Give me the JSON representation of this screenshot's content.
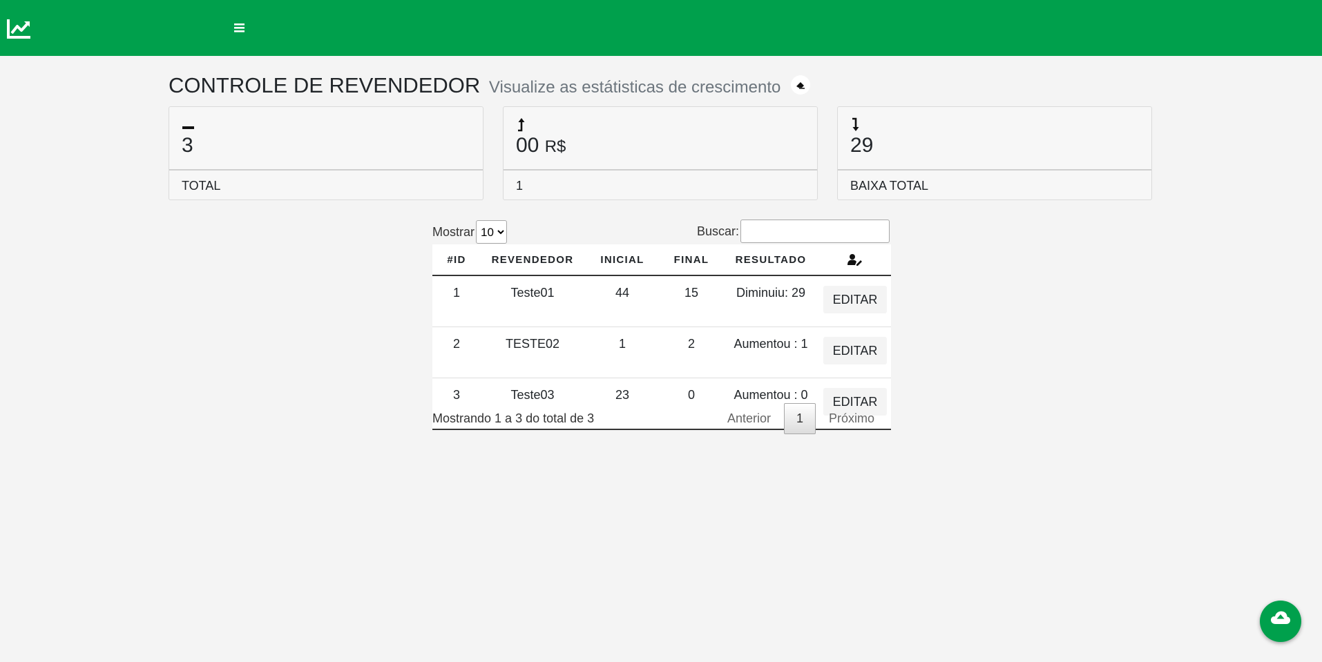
{
  "header": {
    "brand_icon": "chart-line-icon",
    "menu_icon": "bars-icon",
    "accent": "#00a04c"
  },
  "page": {
    "title": "CONTROLE DE REVENDEDOR",
    "subtitle": "Visualize as estátisticas de crescimento",
    "title_icon": "eraser-icon"
  },
  "cards": [
    {
      "icon": "minus-icon",
      "value": "3",
      "unit": "",
      "footer": "TOTAL"
    },
    {
      "icon": "arrow-up-icon",
      "value": "00",
      "unit": "R$",
      "footer": "1"
    },
    {
      "icon": "arrow-down-icon",
      "value": "29",
      "unit": "",
      "footer": "BAIXA TOTAL"
    }
  ],
  "table_controls": {
    "length_label": "Mostrar",
    "length_value": "10",
    "search_label": "Buscar:",
    "search_value": ""
  },
  "table": {
    "columns": [
      "#ID",
      "REVENDEDOR",
      "INICIAL",
      "FINAL",
      "RESULTADO"
    ],
    "action_column_icon": "user-edit-icon",
    "rows": [
      {
        "id": "1",
        "revendedor": "Teste01",
        "inicial": "44",
        "final": "15",
        "resultado": "Diminuiu: 29",
        "action": "EDITAR"
      },
      {
        "id": "2",
        "revendedor": "TESTE02",
        "inicial": "1",
        "final": "2",
        "resultado": "Aumentou : 1",
        "action": "EDITAR"
      },
      {
        "id": "3",
        "revendedor": "Teste03",
        "inicial": "23",
        "final": "0",
        "resultado": "Aumentou : 0",
        "action": "EDITAR"
      }
    ]
  },
  "footer": {
    "info": "Mostrando 1 a 3 do total de 3",
    "prev": "Anterior",
    "current_page": "1",
    "next": "Próximo"
  },
  "scroll_top_icon": "cloud-upload-icon"
}
